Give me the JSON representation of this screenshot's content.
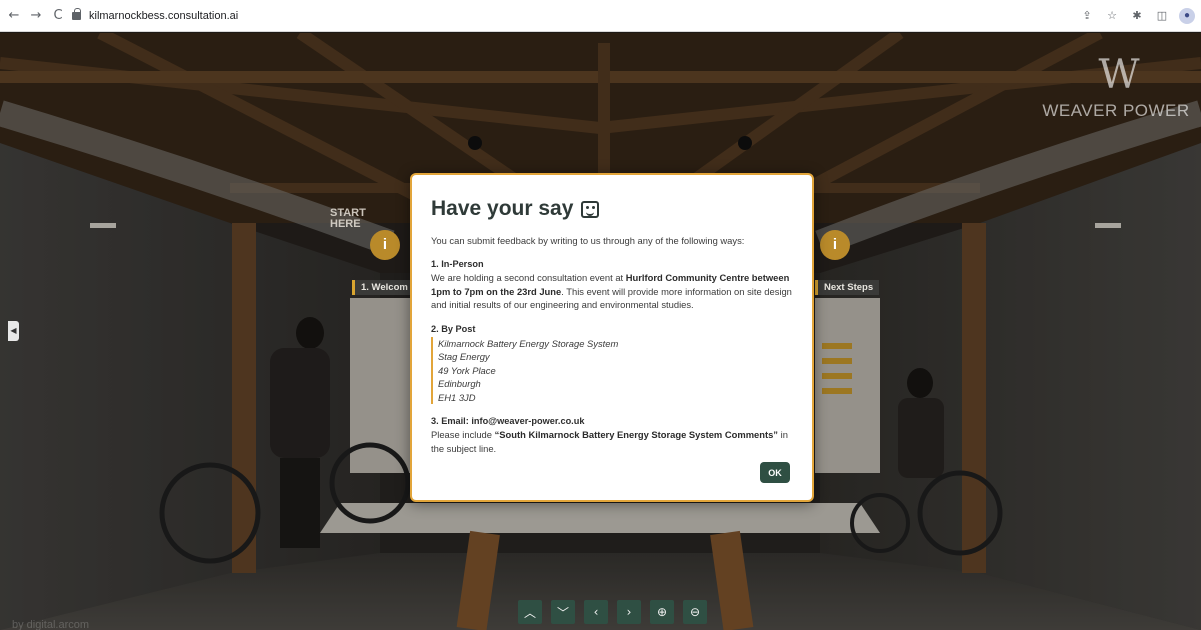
{
  "browser": {
    "url": "kilmarnockbess.consultation.ai",
    "nav": {
      "back": "←",
      "forward": "→",
      "reload": "C"
    },
    "right_icons": [
      "share-icon",
      "star-icon",
      "extensions-icon",
      "sidepanel-icon",
      "profile-icon"
    ]
  },
  "brand": {
    "mark": "W",
    "name": "WEAVER POWER"
  },
  "scene": {
    "start_sign": "START\nHERE",
    "panel_left": "1. Welcom",
    "panel_right": "Next Steps",
    "watermark": "by digital.arcom"
  },
  "modal": {
    "title": "Have your say",
    "intro": "You can submit feedback by writing to us through any of the following ways:",
    "in_person": {
      "heading": "1. In-Person",
      "t1": "We are holding a second consultation event at ",
      "venue": "Hurlford Community Centre between 1pm to 7pm on the 23rd June",
      "t2": ". This event will provide more information on site design and initial results of our engineering and environmental studies."
    },
    "post": {
      "heading": "2. By Post",
      "lines": [
        "Kilmarnock Battery Energy Storage System",
        "Stag Energy",
        "49 York Place",
        "Edinburgh",
        "EH1 3JD"
      ]
    },
    "email": {
      "heading": "3. Email: info@weaver-power.co.uk",
      "t1": "Please include ",
      "subject": "“South Kilmarnock Battery Energy Storage System Comments”",
      "t2": " in the subject line."
    },
    "ok_label": "OK"
  },
  "controls": [
    "up",
    "down",
    "left",
    "right",
    "zoom-in",
    "zoom-out"
  ],
  "colors": {
    "accent": "#e2a53a",
    "button": "#2f4f43"
  }
}
